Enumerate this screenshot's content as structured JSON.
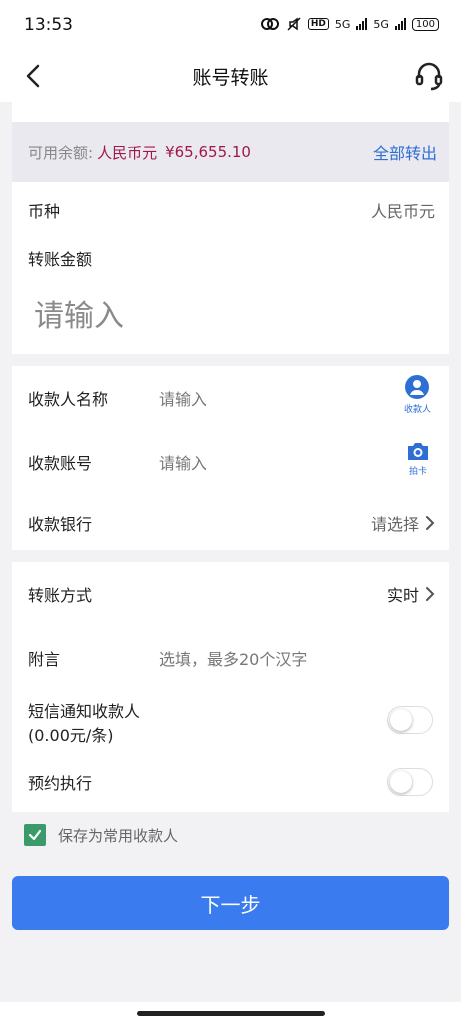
{
  "status_bar": {
    "time": "13:53",
    "hd": "HD",
    "net1": "5G",
    "net2": "5G",
    "battery": "100"
  },
  "nav": {
    "title": "账号转账",
    "back_icon": "chevron-left-icon",
    "service_icon": "headset-icon"
  },
  "balance": {
    "label": "可用余额:",
    "currency": "人民币元",
    "amount": "¥65,655.10",
    "transfer_all": "全部转出"
  },
  "amount_card": {
    "currency_label": "币种",
    "currency_value": "人民币元",
    "amount_label": "转账金额",
    "amount_placeholder": "请输入"
  },
  "payee_card": {
    "name_label": "收款人名称",
    "name_placeholder": "请输入",
    "name_icon_label": "收款人",
    "account_label": "收款账号",
    "account_placeholder": "请输入",
    "account_icon_label": "拍卡",
    "bank_label": "收款银行",
    "bank_value": "请选择"
  },
  "options_card": {
    "method_label": "转账方式",
    "method_value": "实时",
    "note_label": "附言",
    "note_placeholder": "选填，最多20个汉字",
    "sms_label_line1": "短信通知收款人",
    "sms_label_line2": "(0.00元/条)",
    "schedule_label": "预约执行"
  },
  "save_payee": {
    "label": "保存为常用收款人",
    "checked": true
  },
  "next_button": "下一步",
  "colors": {
    "accent": "#3a7cf0",
    "balance": "#a0184a",
    "link": "#2e6fd6",
    "checkbox": "#3a9a6a"
  }
}
